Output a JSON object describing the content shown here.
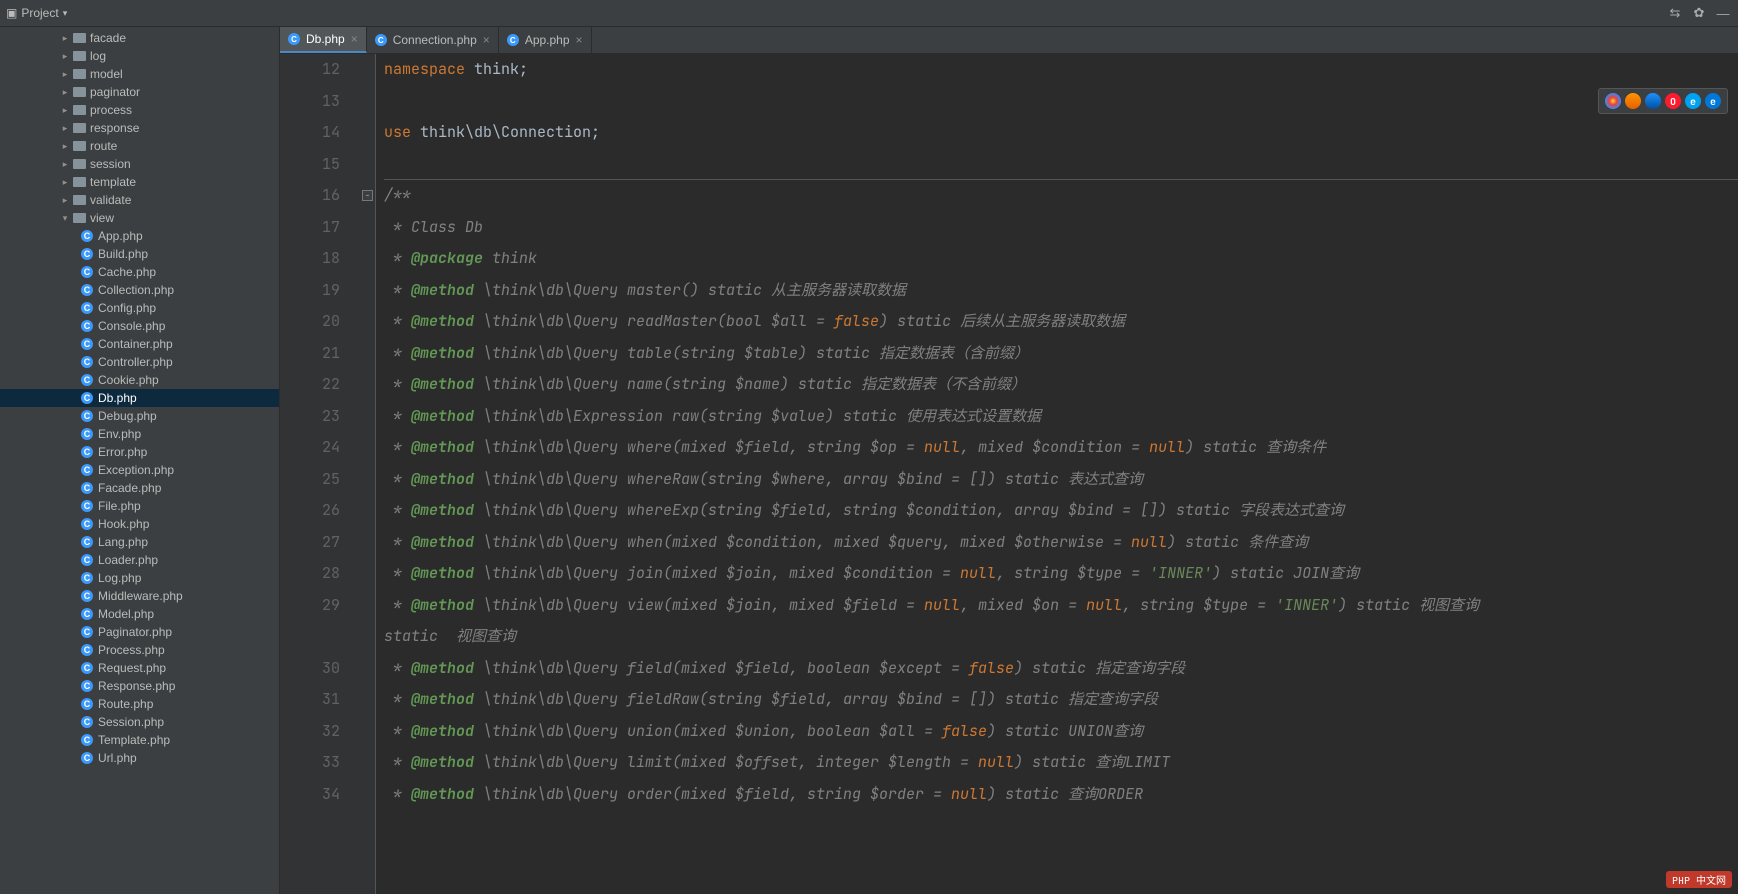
{
  "toolbar": {
    "project_label": "Project"
  },
  "sidebar": {
    "folders": [
      {
        "name": "facade",
        "depth": 60
      },
      {
        "name": "log",
        "depth": 60
      },
      {
        "name": "model",
        "depth": 60
      },
      {
        "name": "paginator",
        "depth": 60
      },
      {
        "name": "process",
        "depth": 60
      },
      {
        "name": "response",
        "depth": 60
      },
      {
        "name": "route",
        "depth": 60
      },
      {
        "name": "session",
        "depth": 60
      },
      {
        "name": "template",
        "depth": 60
      },
      {
        "name": "validate",
        "depth": 60
      },
      {
        "name": "view",
        "depth": 60,
        "open": true
      }
    ],
    "files": [
      "App.php",
      "Build.php",
      "Cache.php",
      "Collection.php",
      "Config.php",
      "Console.php",
      "Container.php",
      "Controller.php",
      "Cookie.php",
      "Db.php",
      "Debug.php",
      "Env.php",
      "Error.php",
      "Exception.php",
      "Facade.php",
      "File.php",
      "Hook.php",
      "Lang.php",
      "Loader.php",
      "Log.php",
      "Middleware.php",
      "Model.php",
      "Paginator.php",
      "Process.php",
      "Request.php",
      "Response.php",
      "Route.php",
      "Session.php",
      "Template.php",
      "Url.php"
    ],
    "selected_file": "Db.php",
    "file_depth": 78
  },
  "tabs": [
    {
      "label": "Db.php",
      "active": true
    },
    {
      "label": "Connection.php",
      "active": false
    },
    {
      "label": "App.php",
      "active": false
    }
  ],
  "browsers": [
    "chrome",
    "firefox",
    "safari",
    "opera",
    "ie",
    "edge"
  ],
  "footer_badge": "PHP 中文网",
  "code": {
    "lines": [
      {
        "n": 12,
        "t": "ns",
        "parts": [
          [
            "kw",
            "namespace"
          ],
          [
            "w",
            " "
          ],
          [
            "p",
            "think;"
          ]
        ]
      },
      {
        "n": 13,
        "t": "blank"
      },
      {
        "n": 14,
        "t": "use",
        "parts": [
          [
            "kw",
            "use"
          ],
          [
            "w",
            " "
          ],
          [
            "p",
            "think\\db\\Connection;"
          ]
        ]
      },
      {
        "n": 15,
        "t": "blank",
        "sep": true
      },
      {
        "n": 16,
        "t": "c",
        "text": "/**",
        "fold": true
      },
      {
        "n": 17,
        "t": "c",
        "text": " * Class Db"
      },
      {
        "n": 18,
        "t": "c",
        "text": " * @package think"
      },
      {
        "n": 19,
        "t": "m",
        "text": " * @method \\think\\db\\Query master() static 从主服务器读取数据"
      },
      {
        "n": 20,
        "t": "m",
        "text": " * @method \\think\\db\\Query readMaster(bool $all = false) static 后续从主服务器读取数据"
      },
      {
        "n": 21,
        "t": "m",
        "text": " * @method \\think\\db\\Query table(string $table) static 指定数据表（含前缀）"
      },
      {
        "n": 22,
        "t": "m",
        "text": " * @method \\think\\db\\Query name(string $name) static 指定数据表（不含前缀）"
      },
      {
        "n": 23,
        "t": "m",
        "text": " * @method \\think\\db\\Expression raw(string $value) static 使用表达式设置数据"
      },
      {
        "n": 24,
        "t": "m",
        "text": " * @method \\think\\db\\Query where(mixed $field, string $op = null, mixed $condition = null) static 查询条件"
      },
      {
        "n": 25,
        "t": "m",
        "text": " * @method \\think\\db\\Query whereRaw(string $where, array $bind = []) static 表达式查询"
      },
      {
        "n": 26,
        "t": "m",
        "text": " * @method \\think\\db\\Query whereExp(string $field, string $condition, array $bind = []) static 字段表达式查询"
      },
      {
        "n": 27,
        "t": "m",
        "text": " * @method \\think\\db\\Query when(mixed $condition, mixed $query, mixed $otherwise = null) static 条件查询"
      },
      {
        "n": 28,
        "t": "m",
        "text": " * @method \\think\\db\\Query join(mixed $join, mixed $condition = null, string $type = 'INNER') static JOIN查询"
      },
      {
        "n": 29,
        "t": "m",
        "text": " * @method \\think\\db\\Query view(mixed $join, mixed $field = null, mixed $on = null, string $type = 'INNER') static 视图查询",
        "wrap": true
      },
      {
        "n": 30,
        "t": "m",
        "text": " * @method \\think\\db\\Query field(mixed $field, boolean $except = false) static 指定查询字段"
      },
      {
        "n": 31,
        "t": "m",
        "text": " * @method \\think\\db\\Query fieldRaw(string $field, array $bind = []) static 指定查询字段"
      },
      {
        "n": 32,
        "t": "m",
        "text": " * @method \\think\\db\\Query union(mixed $union, boolean $all = false) static UNION查询"
      },
      {
        "n": 33,
        "t": "m",
        "text": " * @method \\think\\db\\Query limit(mixed $offset, integer $length = null) static 查询LIMIT"
      },
      {
        "n": 34,
        "t": "m",
        "text": " * @method \\think\\db\\Query order(mixed $field, string $order = null) static 查询ORDER"
      }
    ]
  }
}
